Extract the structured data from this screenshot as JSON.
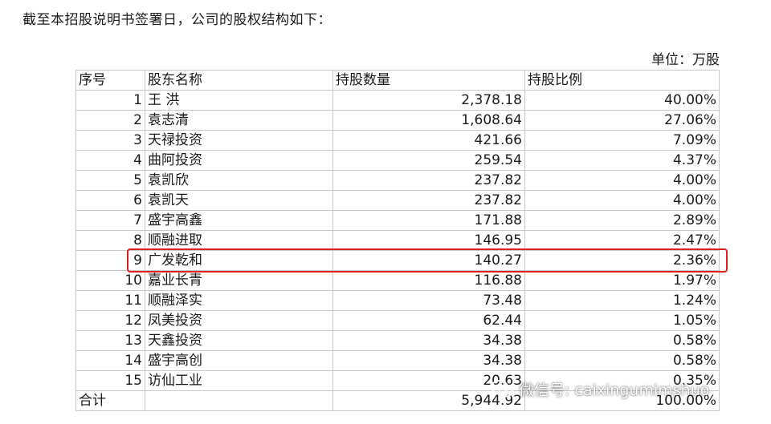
{
  "intro_text": "截至本招股说明书签署日，公司的股权结构如下：",
  "unit_text": "单位：万股",
  "table": {
    "headers": [
      "序号",
      "股东名称",
      "持股数量",
      "持股比例"
    ],
    "rows": [
      {
        "no": "1",
        "name": "王 洪",
        "shares": "2,378.18",
        "ratio": "40.00%"
      },
      {
        "no": "2",
        "name": "袁志清",
        "shares": "1,608.64",
        "ratio": "27.06%"
      },
      {
        "no": "3",
        "name": "天禄投资",
        "shares": "421.66",
        "ratio": "7.09%"
      },
      {
        "no": "4",
        "name": "曲阿投资",
        "shares": "259.54",
        "ratio": "4.37%"
      },
      {
        "no": "5",
        "name": "袁凯欣",
        "shares": "237.82",
        "ratio": "4.00%"
      },
      {
        "no": "6",
        "name": "袁凯天",
        "shares": "237.82",
        "ratio": "4.00%"
      },
      {
        "no": "7",
        "name": "盛宇高鑫",
        "shares": "171.88",
        "ratio": "2.89%"
      },
      {
        "no": "8",
        "name": "顺融进取",
        "shares": "146.95",
        "ratio": "2.47%"
      },
      {
        "no": "9",
        "name": "广发乾和",
        "shares": "140.27",
        "ratio": "2.36%"
      },
      {
        "no": "10",
        "name": "嘉业长青",
        "shares": "116.88",
        "ratio": "1.97%"
      },
      {
        "no": "11",
        "name": "顺融泽实",
        "shares": "73.48",
        "ratio": "1.24%"
      },
      {
        "no": "12",
        "name": "凤美投资",
        "shares": "62.44",
        "ratio": "1.05%"
      },
      {
        "no": "13",
        "name": "天鑫投资",
        "shares": "34.38",
        "ratio": "0.58%"
      },
      {
        "no": "14",
        "name": "盛宇高创",
        "shares": "34.38",
        "ratio": "0.58%"
      },
      {
        "no": "15",
        "name": "访仙工业",
        "shares": "20.63",
        "ratio": "0.35%"
      }
    ],
    "total": {
      "label": "合计",
      "shares": "5,944.92",
      "ratio": "100.00%"
    }
  },
  "highlight": {
    "row_no": "9",
    "color": "#e02020"
  },
  "watermark": {
    "icon": "wechat-icon",
    "text": "微信号: caixingumimshuo"
  }
}
